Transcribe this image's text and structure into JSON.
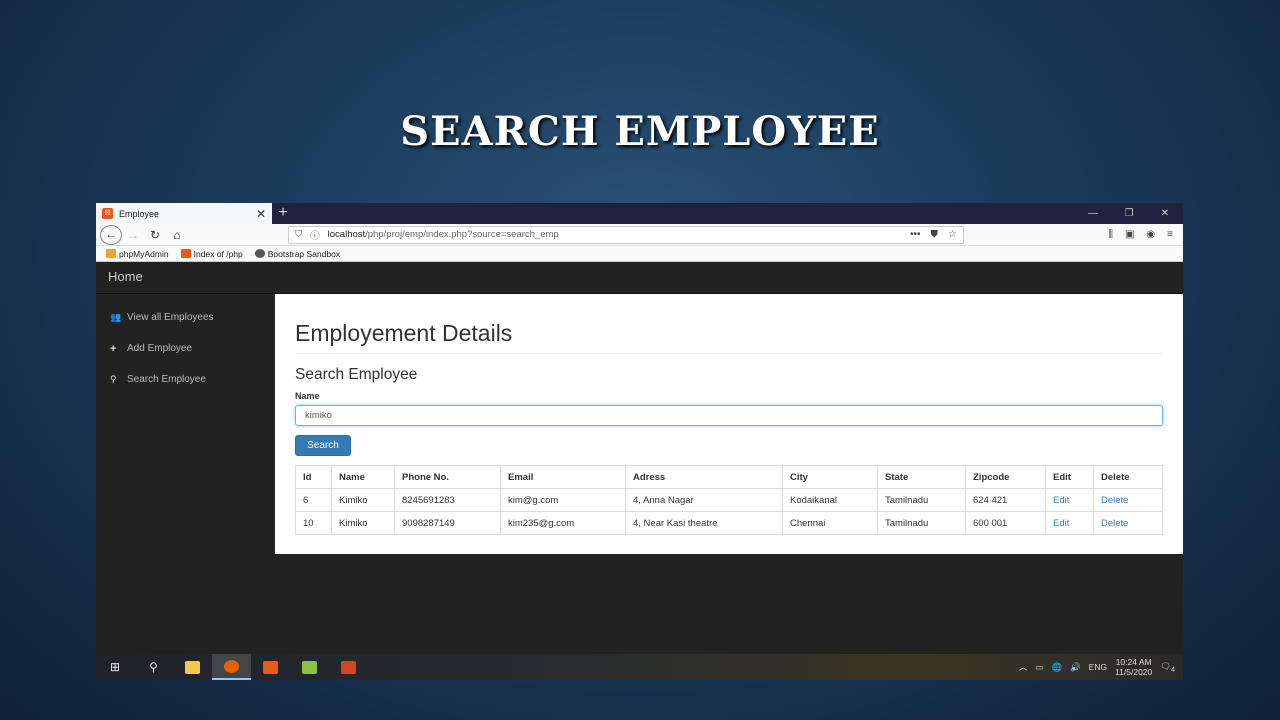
{
  "slide": {
    "title": "SEARCH EMPLOYEE"
  },
  "browser": {
    "tab": {
      "title": "Employee",
      "close": "✕"
    },
    "new_tab": "+",
    "window_controls": {
      "minimize": "—",
      "restore": "❐",
      "close": "✕"
    },
    "address": {
      "host": "localhost",
      "path": "/php/proj/emp/index.php?source=search_emp"
    },
    "bookmarks": [
      {
        "label": "phpMyAdmin",
        "color": "#e8a33c"
      },
      {
        "label": "Index of /php",
        "color": "#e8591c"
      },
      {
        "label": "Bootstrap Sandbox",
        "color": "#555555"
      }
    ]
  },
  "app": {
    "header": {
      "brand": "Home"
    },
    "sidebar": {
      "items": [
        {
          "label": "View all Employees",
          "icon": "users-icon"
        },
        {
          "label": "Add Employee",
          "icon": "plus-icon"
        },
        {
          "label": "Search Employee",
          "icon": "search-icon"
        }
      ]
    },
    "main": {
      "page_title": "Employement Details",
      "section_title": "Search Employee",
      "name_label": "Name",
      "name_value": "kimiko",
      "search_button": "Search",
      "table": {
        "headers": [
          "Id",
          "Name",
          "Phone No.",
          "Email",
          "Adress",
          "City",
          "State",
          "Zipcode",
          "Edit",
          "Delete"
        ],
        "rows": [
          [
            "6",
            "Kimiko",
            "8245691283",
            "kim@g.com",
            "4, Anna Nagar",
            "Kodaikanal",
            "Tamilnadu",
            "624 421",
            "Edit",
            "Delete"
          ],
          [
            "10",
            "Kimiko",
            "9098287149",
            "kim235@g.com",
            "4, Near Kasi theatre",
            "Chennai",
            "Tamilnadu",
            "600 001",
            "Edit",
            "Delete"
          ]
        ]
      }
    }
  },
  "taskbar": {
    "tray": {
      "lang": "ENG",
      "time": "10:24 AM",
      "date": "11/5/2020",
      "notifications": "4"
    }
  },
  "colors": {
    "accent": "#337ab7",
    "navbar": "#222222"
  }
}
